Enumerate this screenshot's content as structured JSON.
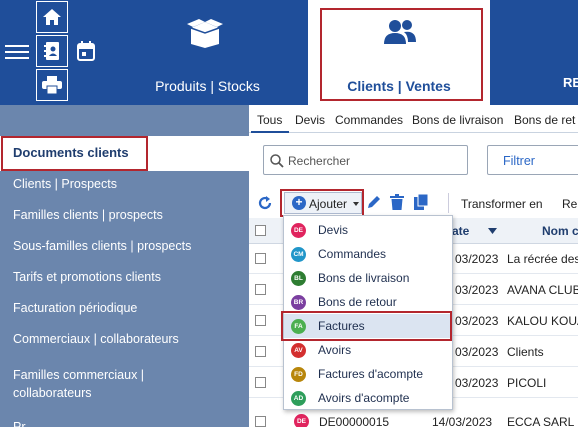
{
  "topbar": {
    "nav": [
      {
        "label": "Produits | Stocks"
      },
      {
        "label": "Clients | Ventes"
      }
    ]
  },
  "sidebar": {
    "items": [
      {
        "label": "Documents clients"
      },
      {
        "label": "Clients | Prospects"
      },
      {
        "label": "Familles clients | prospects"
      },
      {
        "label": "Sous-familles clients | prospects"
      },
      {
        "label": "Tarifs et promotions clients"
      },
      {
        "label": "Facturation périodique"
      },
      {
        "label": "Commerciaux | collaborateurs"
      },
      {
        "label": "Familles commerciaux |"
      },
      {
        "label": "collaborateurs"
      }
    ]
  },
  "tabs": [
    "Tous",
    "Devis",
    "Commandes",
    "Bons de livraison",
    "Bons de ret"
  ],
  "search": {
    "placeholder": "Rechercher"
  },
  "filter_label": "Filtrer",
  "toolbar": {
    "add_label": "Ajouter",
    "transform_label": "Transformer en",
    "more_label": "Re"
  },
  "table": {
    "headers": [
      "ate",
      "Nom c"
    ],
    "rows": [
      {
        "date": "03/2023",
        "name": "La récrée des"
      },
      {
        "date": "03/2023",
        "name": "AVANA CLUB"
      },
      {
        "date": "03/2023",
        "name": "KALOU KOUA"
      },
      {
        "date": "03/2023",
        "name": "Clients"
      },
      {
        "date": "03/2023",
        "name": "PICOLI"
      },
      {
        "code": "DE00000015",
        "date": "14/03/2023",
        "name": "ECCA SARL"
      }
    ]
  },
  "dropdown": {
    "items": [
      {
        "badge": "DE",
        "label": "Devis",
        "color": "#e0245e"
      },
      {
        "badge": "CM",
        "label": "Commandes",
        "color": "#2196c9"
      },
      {
        "badge": "BL",
        "label": "Bons de livraison",
        "color": "#2e7d32"
      },
      {
        "badge": "BR",
        "label": "Bons de retour",
        "color": "#7b3fa0"
      },
      {
        "badge": "FA",
        "label": "Factures",
        "color": "#4caf50"
      },
      {
        "badge": "AV",
        "label": "Avoirs",
        "color": "#d32f2f"
      },
      {
        "badge": "FD",
        "label": "Factures d'acompte",
        "color": "#b8860b"
      },
      {
        "badge": "AD",
        "label": "Avoirs d'acompte",
        "color": "#2e9e5b"
      }
    ]
  },
  "colors": {
    "brand": "#1f4e9a",
    "sidebar": "#6b86ad",
    "highlight": "#b3262e"
  }
}
